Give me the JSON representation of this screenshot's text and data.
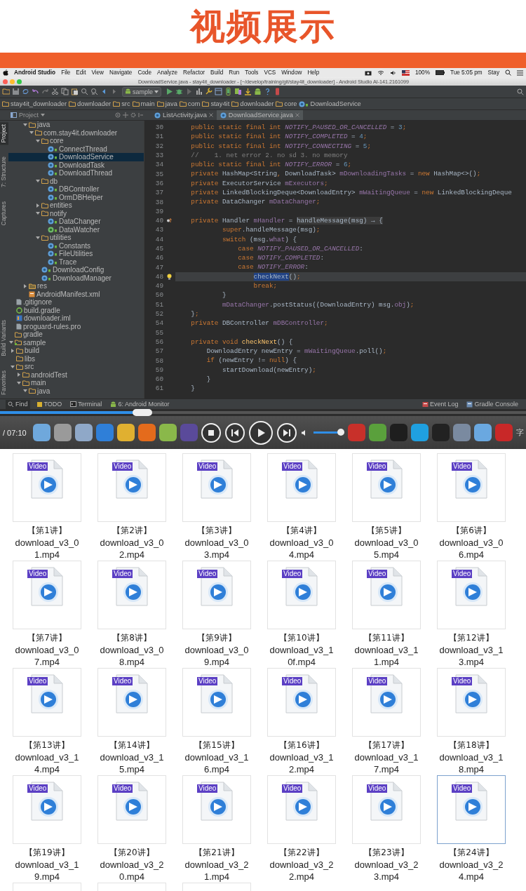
{
  "banner": {
    "title": "视频展示"
  },
  "menubar": {
    "app": "Android Studio",
    "menus": [
      "File",
      "Edit",
      "View",
      "Navigate",
      "Code",
      "Analyze",
      "Refactor",
      "Build",
      "Run",
      "Tools",
      "VCS",
      "Window",
      "Help"
    ],
    "battery": "100%",
    "clock": "Tue 5:05 pm",
    "user": "Stay"
  },
  "window": {
    "title": "DownloadService.java - stay4it_downloader - [~/develop/training/git/stay4it_downloader] - Android Studio AI-141.2161099"
  },
  "toolbar": {
    "run_config": "sample"
  },
  "breadcrumbs": [
    {
      "label": "stay4it_downloader",
      "kind": "folder"
    },
    {
      "label": "downloader",
      "kind": "folder"
    },
    {
      "label": "src",
      "kind": "folder"
    },
    {
      "label": "main",
      "kind": "folder"
    },
    {
      "label": "java",
      "kind": "folder"
    },
    {
      "label": "com",
      "kind": "folder"
    },
    {
      "label": "stay4it",
      "kind": "folder"
    },
    {
      "label": "downloader",
      "kind": "folder"
    },
    {
      "label": "core",
      "kind": "folder"
    },
    {
      "label": "DownloadService",
      "kind": "class"
    }
  ],
  "side_tabs_top": [
    {
      "label": "Project",
      "selected": true
    },
    {
      "label": "7: Structure",
      "selected": false
    },
    {
      "label": "Captures",
      "selected": false
    }
  ],
  "side_tabs_bottom": [
    {
      "label": "Build Variants",
      "selected": false
    },
    {
      "label": "Favorites",
      "selected": false
    }
  ],
  "project_panel": {
    "title": "Project",
    "tree": [
      {
        "children": [
          {
            "children": [
              {
                "children": [
                  {
                    "label": "java",
                    "kind": "folder",
                    "expanded": true,
                    "selected": false,
                    "children": [
                      {
                        "label": "com.stay4it.downloader",
                        "kind": "folder",
                        "expanded": true,
                        "selected": false,
                        "children": [
                          {
                            "label": "core",
                            "kind": "folder",
                            "expanded": true,
                            "selected": false,
                            "children": [
                              {
                                "label": "ConnectThread",
                                "kind": "class",
                                "selected": false
                              },
                              {
                                "label": "DownloadService",
                                "kind": "class",
                                "selected": true
                              },
                              {
                                "label": "DownloadTask",
                                "kind": "class",
                                "selected": false
                              },
                              {
                                "label": "DownloadThread",
                                "kind": "class",
                                "selected": false
                              }
                            ]
                          },
                          {
                            "label": "db",
                            "kind": "folder",
                            "expanded": true,
                            "selected": false,
                            "children": [
                              {
                                "label": "DBController",
                                "kind": "class",
                                "selected": false
                              },
                              {
                                "label": "OrmDBHelper",
                                "kind": "class",
                                "selected": false
                              }
                            ]
                          },
                          {
                            "label": "entities",
                            "kind": "folder",
                            "expanded": false,
                            "selected": false
                          },
                          {
                            "label": "notify",
                            "kind": "folder",
                            "expanded": true,
                            "selected": false,
                            "children": [
                              {
                                "label": "DataChanger",
                                "kind": "class",
                                "selected": false
                              },
                              {
                                "label": "DataWatcher",
                                "kind": "interface",
                                "selected": false
                              }
                            ]
                          },
                          {
                            "label": "utilities",
                            "kind": "folder",
                            "expanded": true,
                            "selected": false,
                            "children": [
                              {
                                "label": "Constants",
                                "kind": "class",
                                "selected": false
                              },
                              {
                                "label": "FileUtilities",
                                "kind": "class",
                                "selected": false
                              },
                              {
                                "label": "Trace",
                                "kind": "class",
                                "selected": false
                              }
                            ]
                          },
                          {
                            "label": "DownloadConfig",
                            "kind": "class",
                            "selected": false
                          },
                          {
                            "label": "DownloadManager",
                            "kind": "class",
                            "selected": false
                          }
                        ]
                      }
                    ]
                  },
                  {
                    "label": "res",
                    "kind": "res-folder",
                    "expanded": false,
                    "selected": false
                  },
                  {
                    "label": "AndroidManifest.xml",
                    "kind": "manifest",
                    "selected": false
                  }
                ]
              }
            ]
          },
          {
            "label": ".gitignore",
            "kind": "text",
            "selected": false
          },
          {
            "label": "build.gradle",
            "kind": "gradle",
            "selected": false
          },
          {
            "label": "downloader.iml",
            "kind": "module",
            "selected": false
          },
          {
            "label": "proguard-rules.pro",
            "kind": "text",
            "selected": false
          }
        ]
      },
      {
        "label": "gradle",
        "kind": "folder",
        "selected": false
      },
      {
        "label": "sample",
        "kind": "module-folder",
        "expanded": true,
        "selected": false,
        "children": [
          {
            "label": "build",
            "kind": "folder",
            "expanded": false,
            "selected": false
          },
          {
            "label": "libs",
            "kind": "folder",
            "selected": false
          },
          {
            "label": "src",
            "kind": "folder",
            "expanded": true,
            "selected": false,
            "children": [
              {
                "label": "androidTest",
                "kind": "folder",
                "expanded": false,
                "selected": false
              },
              {
                "label": "main",
                "kind": "folder",
                "expanded": true,
                "selected": false,
                "children": [
                  {
                    "label": "java",
                    "kind": "folder",
                    "expanded": true,
                    "selected": false
                  }
                ]
              }
            ]
          }
        ]
      }
    ]
  },
  "editor_tabs": [
    {
      "label": "ListActivity.java",
      "selected": false
    },
    {
      "label": "DownloadService.java",
      "selected": true
    }
  ],
  "editor": {
    "lines": [
      {
        "number": "30",
        "current": false,
        "tokens": [
          {
            "kind": "kw",
            "text": "    public static final int "
          },
          {
            "kind": "const",
            "text": "NOTIFY_PAUSED_OR_CANCELLED"
          },
          {
            "kind": "plain",
            "text": " = "
          },
          {
            "kind": "num",
            "text": "3"
          },
          {
            "kind": "kw",
            "text": ";"
          }
        ]
      },
      {
        "number": "31",
        "current": false,
        "tokens": [
          {
            "kind": "kw",
            "text": "    public static final int "
          },
          {
            "kind": "const",
            "text": "NOTIFY_COMPLETED"
          },
          {
            "kind": "plain",
            "text": " = "
          },
          {
            "kind": "num",
            "text": "4"
          },
          {
            "kind": "kw",
            "text": ";"
          }
        ]
      },
      {
        "number": "32",
        "current": false,
        "tokens": [
          {
            "kind": "kw",
            "text": "    public static final int "
          },
          {
            "kind": "const",
            "text": "NOTIFY_CONNECTING"
          },
          {
            "kind": "plain",
            "text": " = "
          },
          {
            "kind": "num",
            "text": "5"
          },
          {
            "kind": "kw",
            "text": ";"
          }
        ]
      },
      {
        "number": "33",
        "current": false,
        "tokens": [
          {
            "kind": "comment",
            "text": "    //    1. net error 2. no sd 3. no memory"
          }
        ]
      },
      {
        "number": "34",
        "current": false,
        "tokens": [
          {
            "kind": "kw",
            "text": "    public static final int "
          },
          {
            "kind": "const",
            "text": "NOTIFY_ERROR"
          },
          {
            "kind": "plain",
            "text": " = "
          },
          {
            "kind": "num",
            "text": "6"
          },
          {
            "kind": "kw",
            "text": ";"
          }
        ]
      },
      {
        "number": "35",
        "current": false,
        "tokens": [
          {
            "kind": "kw",
            "text": "    private "
          },
          {
            "kind": "plain",
            "text": "HashMap<String"
          },
          {
            "kind": "kw",
            "text": ", "
          },
          {
            "kind": "plain",
            "text": "DownloadTask> "
          },
          {
            "kind": "field",
            "text": "mDownloadingTasks"
          },
          {
            "kind": "plain",
            "text": " = "
          },
          {
            "kind": "kw",
            "text": "new "
          },
          {
            "kind": "plain",
            "text": "HashMap<>()"
          },
          {
            "kind": "kw",
            "text": ";"
          }
        ]
      },
      {
        "number": "36",
        "current": false,
        "tokens": [
          {
            "kind": "kw",
            "text": "    private "
          },
          {
            "kind": "plain",
            "text": "ExecutorService "
          },
          {
            "kind": "field",
            "text": "mExecutors"
          },
          {
            "kind": "kw",
            "text": ";"
          }
        ]
      },
      {
        "number": "37",
        "current": false,
        "tokens": [
          {
            "kind": "kw",
            "text": "    private "
          },
          {
            "kind": "plain",
            "text": "LinkedBlockingDeque<DownloadEntry> "
          },
          {
            "kind": "field",
            "text": "mWaitingQueue"
          },
          {
            "kind": "plain",
            "text": " = "
          },
          {
            "kind": "kw",
            "text": "new "
          },
          {
            "kind": "plain",
            "text": "LinkedBlockingDeque"
          }
        ]
      },
      {
        "number": "38",
        "current": false,
        "tokens": [
          {
            "kind": "kw",
            "text": "    private "
          },
          {
            "kind": "plain",
            "text": "DataChanger "
          },
          {
            "kind": "field",
            "text": "mDataChanger"
          },
          {
            "kind": "kw",
            "text": ";"
          }
        ]
      },
      {
        "number": "39",
        "current": false
      },
      {
        "number": "40",
        "current": false,
        "marker": {
          "kind": "override"
        },
        "tokens": [
          {
            "kind": "kw",
            "text": "    private "
          },
          {
            "kind": "plain",
            "text": "Handler "
          },
          {
            "kind": "field",
            "text": "mHandler"
          },
          {
            "kind": "plain",
            "text": " = "
          },
          {
            "kind": "fold",
            "text": "handleMessage(msg) → {"
          }
        ]
      },
      {
        "number": "43",
        "current": false,
        "tokens": [
          {
            "kind": "kw",
            "text": "            super"
          },
          {
            "kind": "plain",
            "text": ".handleMessage(msg)"
          },
          {
            "kind": "kw",
            "text": ";"
          }
        ]
      },
      {
        "number": "44",
        "current": false,
        "tokens": [
          {
            "kind": "kw",
            "text": "            switch "
          },
          {
            "kind": "plain",
            "text": "(msg."
          },
          {
            "kind": "field",
            "text": "what"
          },
          {
            "kind": "plain",
            "text": ") {"
          }
        ]
      },
      {
        "number": "45",
        "current": false,
        "tokens": [
          {
            "kind": "kw",
            "text": "                case "
          },
          {
            "kind": "const",
            "text": "NOTIFY_PAUSED_OR_CANCELLED"
          },
          {
            "kind": "plain",
            "text": ":"
          }
        ]
      },
      {
        "number": "46",
        "current": false,
        "tokens": [
          {
            "kind": "kw",
            "text": "                case "
          },
          {
            "kind": "const",
            "text": "NOTIFY_COMPLETED"
          },
          {
            "kind": "plain",
            "text": ":"
          }
        ]
      },
      {
        "number": "47",
        "current": false,
        "tokens": [
          {
            "kind": "kw",
            "text": "                case "
          },
          {
            "kind": "const",
            "text": "NOTIFY_ERROR"
          },
          {
            "kind": "plain",
            "text": ":"
          }
        ]
      },
      {
        "number": "48",
        "current": true,
        "marker": {
          "kind": "bulb"
        },
        "tokens": [
          {
            "kind": "sel",
            "text": "                    checkNext"
          },
          {
            "kind": "plain",
            "text": "()"
          },
          {
            "kind": "kw",
            "text": ";"
          }
        ]
      },
      {
        "number": "49",
        "current": false,
        "tokens": [
          {
            "kind": "kw",
            "text": "                    break;"
          }
        ]
      },
      {
        "number": "50",
        "current": false,
        "tokens": [
          {
            "kind": "plain",
            "text": "            }"
          }
        ]
      },
      {
        "number": "51",
        "current": false,
        "tokens": [
          {
            "kind": "field",
            "text": "            mDataChanger"
          },
          {
            "kind": "plain",
            "text": ".postStatus((DownloadEntry) msg."
          },
          {
            "kind": "field",
            "text": "obj"
          },
          {
            "kind": "plain",
            "text": ")"
          },
          {
            "kind": "kw",
            "text": ";"
          }
        ]
      },
      {
        "number": "52",
        "current": false,
        "tokens": [
          {
            "kind": "plain",
            "text": "    }"
          },
          {
            "kind": "kw",
            "text": ";"
          }
        ]
      },
      {
        "number": "54",
        "current": false,
        "tokens": [
          {
            "kind": "kw",
            "text": "    private "
          },
          {
            "kind": "plain",
            "text": "DBController "
          },
          {
            "kind": "field",
            "text": "mDBController"
          },
          {
            "kind": "kw",
            "text": ";"
          }
        ]
      },
      {
        "number": "55",
        "current": false
      },
      {
        "number": "56",
        "current": false,
        "tokens": [
          {
            "kind": "kw",
            "text": "    private void "
          },
          {
            "kind": "method",
            "text": "checkNext"
          },
          {
            "kind": "plain",
            "text": "() {"
          }
        ]
      },
      {
        "number": "57",
        "current": false,
        "tokens": [
          {
            "kind": "plain",
            "text": "        DownloadEntry newEntry = "
          },
          {
            "kind": "field",
            "text": "mWaitingQueue"
          },
          {
            "kind": "plain",
            "text": ".poll()"
          },
          {
            "kind": "kw",
            "text": ";"
          }
        ]
      },
      {
        "number": "58",
        "current": false,
        "tokens": [
          {
            "kind": "kw",
            "text": "        if "
          },
          {
            "kind": "plain",
            "text": "(newEntry != "
          },
          {
            "kind": "kw",
            "text": "null"
          },
          {
            "kind": "plain",
            "text": ") {"
          }
        ]
      },
      {
        "number": "59",
        "current": false,
        "tokens": [
          {
            "kind": "plain",
            "text": "            startDownload(newEntry)"
          },
          {
            "kind": "kw",
            "text": ";"
          }
        ]
      },
      {
        "number": "60",
        "current": false,
        "tokens": [
          {
            "kind": "plain",
            "text": "        }"
          }
        ]
      },
      {
        "number": "61",
        "current": false,
        "tokens": [
          {
            "kind": "plain",
            "text": "    }"
          }
        ]
      }
    ]
  },
  "bottom_tools": [
    {
      "label": "Find",
      "selected": true
    },
    {
      "label": "TODO",
      "selected": false
    },
    {
      "label": "Terminal",
      "selected": false
    },
    {
      "label": "6: Android Monitor",
      "selected": false
    }
  ],
  "bottom_tools_right": [
    {
      "label": "Event Log"
    },
    {
      "label": "Gradle Console"
    }
  ],
  "player": {
    "progress": {
      "level": 0.27
    },
    "time": "/ 07:10",
    "volume": {
      "level": 0.9
    }
  },
  "dock": {
    "apps_left": [
      {
        "color": "#6fa8dc"
      },
      {
        "color": "#9a9a9a"
      },
      {
        "color": "#8fa8c8"
      },
      {
        "color": "#2f7fd8"
      },
      {
        "color": "#e0b030"
      },
      {
        "color": "#e46b1c"
      },
      {
        "color": "#8ab84a"
      },
      {
        "color": "#5a4a9a"
      }
    ],
    "apps_right": [
      {
        "color": "#c8302a"
      },
      {
        "color": "#5aa03c"
      },
      {
        "color": "#1e1e1e"
      },
      {
        "color": "#1fa0e0"
      },
      {
        "color": "#222222"
      },
      {
        "color": "#7a8aa0"
      },
      {
        "color": "#6aa8e0"
      },
      {
        "color": "#c82828"
      }
    ],
    "label": "字"
  },
  "files": [
    {
      "title": "【第1讲】",
      "name": "download_v3_01.mp4",
      "badge": "Video",
      "selected": false
    },
    {
      "title": "【第2讲】",
      "name": "download_v3_02.mp4",
      "badge": "Video",
      "selected": false
    },
    {
      "title": "【第3讲】",
      "name": "download_v3_03.mp4",
      "badge": "Video",
      "selected": false
    },
    {
      "title": "【第4讲】",
      "name": "download_v3_04.mp4",
      "badge": "Video",
      "selected": false
    },
    {
      "title": "【第5讲】",
      "name": "download_v3_05.mp4",
      "badge": "Video",
      "selected": false
    },
    {
      "title": "【第6讲】",
      "name": "download_v3_06.mp4",
      "badge": "Video",
      "selected": false
    },
    {
      "title": "【第7讲】",
      "name": "download_v3_07.mp4",
      "badge": "Video",
      "selected": false
    },
    {
      "title": "【第8讲】",
      "name": "download_v3_08.mp4",
      "badge": "Video",
      "selected": false
    },
    {
      "title": "【第9讲】",
      "name": "download_v3_09.mp4",
      "badge": "Video",
      "selected": false
    },
    {
      "title": "【第10讲】",
      "name": "download_v3_10f.mp4",
      "badge": "Video",
      "selected": false
    },
    {
      "title": "【第11讲】",
      "name": "download_v3_11.mp4",
      "badge": "Video",
      "selected": false
    },
    {
      "title": "【第12讲】",
      "name": "download_v3_13.mp4",
      "badge": "Video",
      "selected": false
    },
    {
      "title": "【第13讲】",
      "name": "download_v3_14.mp4",
      "badge": "Video",
      "selected": false
    },
    {
      "title": "【第14讲】",
      "name": "download_v3_15.mp4",
      "badge": "Video",
      "selected": false
    },
    {
      "title": "【第15讲】",
      "name": "download_v3_16.mp4",
      "badge": "Video",
      "selected": false
    },
    {
      "title": "【第16讲】",
      "name": "download_v3_12.mp4",
      "badge": "Video",
      "selected": false
    },
    {
      "title": "【第17讲】",
      "name": "download_v3_17.mp4",
      "badge": "Video",
      "selected": false
    },
    {
      "title": "【第18讲】",
      "name": "download_v3_18.mp4",
      "badge": "Video",
      "selected": false
    },
    {
      "title": "【第19讲】",
      "name": "download_v3_19.mp4",
      "badge": "Video",
      "selected": false
    },
    {
      "title": "【第20讲】",
      "name": "download_v3_20.mp4",
      "badge": "Video",
      "selected": false
    },
    {
      "title": "【第21讲】",
      "name": "download_v3_21.mp4",
      "badge": "Video",
      "selected": false
    },
    {
      "title": "【第22讲】",
      "name": "download_v3_22.mp4",
      "badge": "Video",
      "selected": false
    },
    {
      "title": "【第23讲】",
      "name": "download_v3_23.mp4",
      "badge": "Video",
      "selected": false
    },
    {
      "title": "【第24讲】",
      "name": "download_v3_24.mp4",
      "badge": "Video",
      "selected": true
    }
  ],
  "partial_tiles": [
    {
      "kind": "video"
    },
    {
      "kind": "video"
    },
    {
      "kind": "video"
    }
  ]
}
